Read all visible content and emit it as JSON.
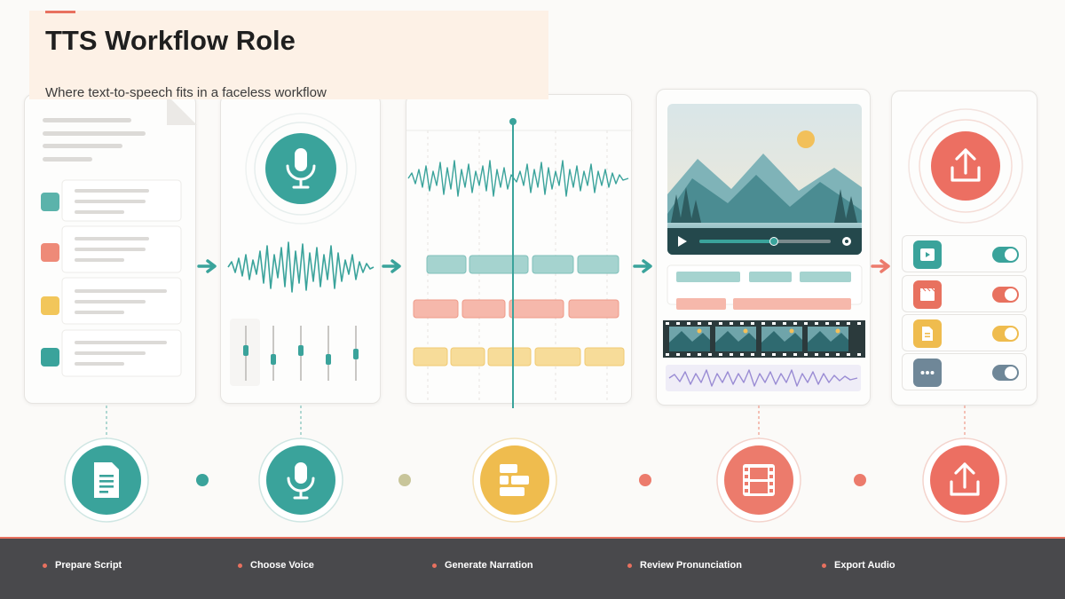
{
  "header": {
    "title": "TTS Workflow Role",
    "subtitle": "Where text-to-speech fits in a faceless workflow"
  },
  "steps": [
    {
      "label": "Prepare Script",
      "icon": "document-icon",
      "color": "#3aa39b"
    },
    {
      "label": "Choose Voice",
      "icon": "microphone-icon",
      "color": "#3aa39b"
    },
    {
      "label": "Generate Narration",
      "icon": "timeline-icon",
      "color": "#efbc4e"
    },
    {
      "label": "Review Pronunciation",
      "icon": "film-icon",
      "color": "#e8715f"
    },
    {
      "label": "Export Audio",
      "icon": "upload-icon",
      "color": "#e8715f"
    }
  ],
  "colors": {
    "teal": "#3aa39b",
    "coral": "#e8715f",
    "yellow": "#efbc4e",
    "slate": "#6f8798",
    "purple": "#9a8cd4",
    "footer": "#49494c"
  },
  "export_options": [
    {
      "icon": "video-icon",
      "color": "#3aa39b",
      "enabled": true
    },
    {
      "icon": "clapperboard-icon",
      "color": "#e8715f",
      "enabled": true
    },
    {
      "icon": "file-icon",
      "color": "#efbc4e",
      "enabled": true
    },
    {
      "icon": "more-icon",
      "color": "#6f8798",
      "enabled": true
    }
  ]
}
